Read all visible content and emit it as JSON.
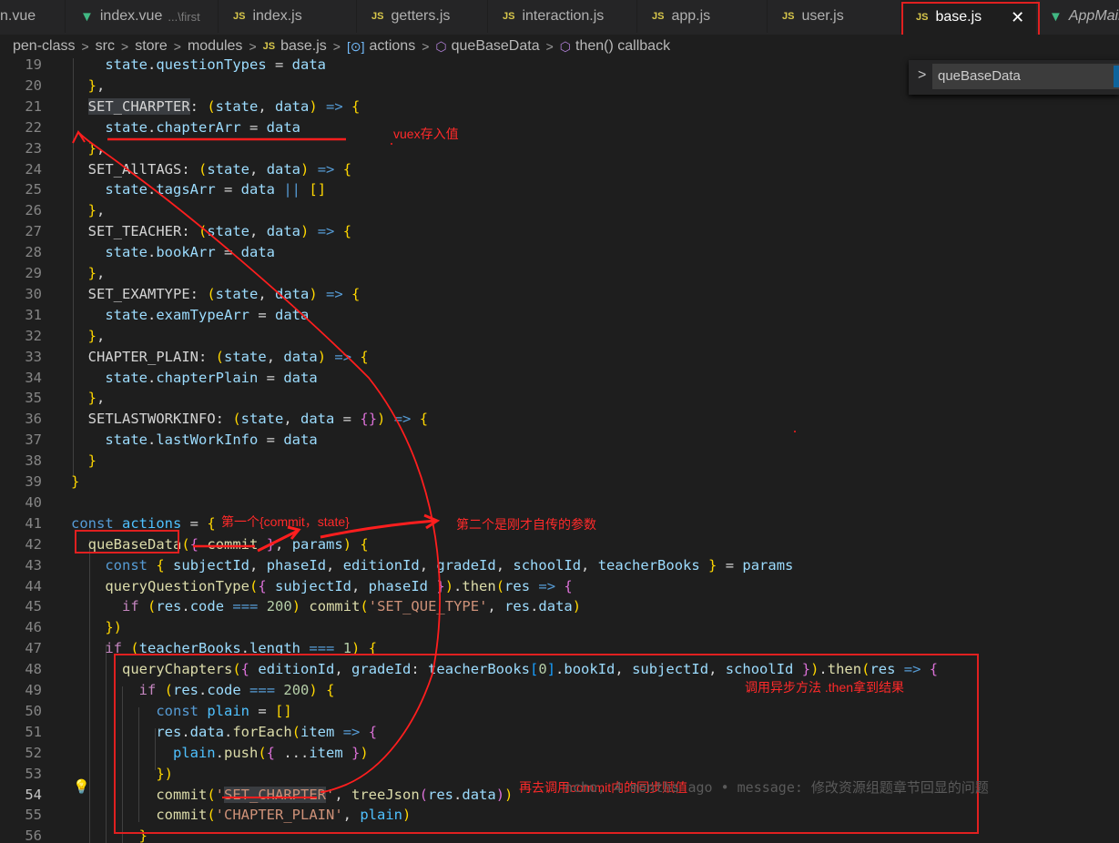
{
  "tabs": [
    {
      "label": "n.vue",
      "kind": "vue"
    },
    {
      "label": "index.vue",
      "desc": "...\\first",
      "kind": "vue"
    },
    {
      "label": "index.js",
      "kind": "js"
    },
    {
      "label": "getters.js",
      "kind": "js"
    },
    {
      "label": "interaction.js",
      "kind": "js"
    },
    {
      "label": "app.js",
      "kind": "js"
    },
    {
      "label": "user.js",
      "kind": "js"
    },
    {
      "label": "base.js",
      "kind": "js",
      "active": true,
      "close": "✕"
    },
    {
      "label": "AppMain",
      "kind": "vue"
    }
  ],
  "breadcrumb": {
    "parts": [
      "pen-class",
      "src",
      "store",
      "modules"
    ],
    "file": "base.js",
    "actions": "actions",
    "func": "queBaseData",
    "callback": "then() callback",
    "js_badge": "JS",
    "sep": ">"
  },
  "find_widget": {
    "value": "queBaseData",
    "chevron": ">"
  },
  "annotations": {
    "vuex_store": "vuex存入值",
    "first_param": "第一个{commit，state}",
    "second_param": "第二个是刚才自传的参数",
    "async_call": "调用异步方法 .then拿到结果",
    "sync_commit": "再去调用commit内的同步赋值"
  },
  "blame": "ncho, 4 months ago • message: 修改资源组题章节回显的问题",
  "lines": [
    {
      "n": "19",
      "code": "    state.questionTypes = data"
    },
    {
      "n": "20",
      "code": "  },"
    },
    {
      "n": "21",
      "code": "  SET_CHARPTER: (state, data) => {"
    },
    {
      "n": "22",
      "code": "    state.chapterArr = data"
    },
    {
      "n": "23",
      "code": "  },"
    },
    {
      "n": "24",
      "code": "  SET_AllTAGS: (state, data) => {"
    },
    {
      "n": "25",
      "code": "    state.tagsArr = data || []"
    },
    {
      "n": "26",
      "code": "  },"
    },
    {
      "n": "27",
      "code": "  SET_TEACHER: (state, data) => {"
    },
    {
      "n": "28",
      "code": "    state.bookArr = data"
    },
    {
      "n": "29",
      "code": "  },"
    },
    {
      "n": "30",
      "code": "  SET_EXAMTYPE: (state, data) => {"
    },
    {
      "n": "31",
      "code": "    state.examTypeArr = data"
    },
    {
      "n": "32",
      "code": "  },"
    },
    {
      "n": "33",
      "code": "  CHAPTER_PLAIN: (state, data) => {"
    },
    {
      "n": "34",
      "code": "    state.chapterPlain = data"
    },
    {
      "n": "35",
      "code": "  },"
    },
    {
      "n": "36",
      "code": "  SETLASTWORKINFO: (state, data = {}) => {"
    },
    {
      "n": "37",
      "code": "    state.lastWorkInfo = data"
    },
    {
      "n": "38",
      "code": "  }"
    },
    {
      "n": "39",
      "code": "}"
    },
    {
      "n": "40",
      "code": ""
    },
    {
      "n": "41",
      "code": "const actions = {"
    },
    {
      "n": "42",
      "code": "  queBaseData({ commit }, params) {"
    },
    {
      "n": "43",
      "code": "    const { subjectId, phaseId, editionId, gradeId, schoolId, teacherBooks } = params"
    },
    {
      "n": "44",
      "code": "    queryQuestionType({ subjectId, phaseId }).then(res => {"
    },
    {
      "n": "45",
      "code": "      if (res.code === 200) commit('SET_QUE_TYPE', res.data)"
    },
    {
      "n": "46",
      "code": "    })"
    },
    {
      "n": "47",
      "code": "    if (teacherBooks.length === 1) {"
    },
    {
      "n": "48",
      "code": "      queryChapters({ editionId, gradeId: teacherBooks[0].bookId, subjectId, schoolId }).then(res => {"
    },
    {
      "n": "49",
      "code": "        if (res.code === 200) {"
    },
    {
      "n": "50",
      "code": "          const plain = []"
    },
    {
      "n": "51",
      "code": "          res.data.forEach(item => {"
    },
    {
      "n": "52",
      "code": "            plain.push({ ...item })"
    },
    {
      "n": "53",
      "code": "          })"
    },
    {
      "n": "54",
      "code": "          commit('SET_CHARPTER', treeJson(res.data))"
    },
    {
      "n": "55",
      "code": "          commit('CHAPTER_PLAIN', plain)"
    },
    {
      "n": "56",
      "code": "        }"
    }
  ],
  "colors": {
    "annotation": "#ff2a2a",
    "tab_js": "#d9c84b",
    "tab_vue": "#41b883"
  },
  "icons": [
    "vue-file-icon",
    "js-file-icon",
    "close-icon",
    "chevron-right-icon",
    "lightbulb-icon",
    "symbol-namespace-icon",
    "symbol-method-icon"
  ]
}
